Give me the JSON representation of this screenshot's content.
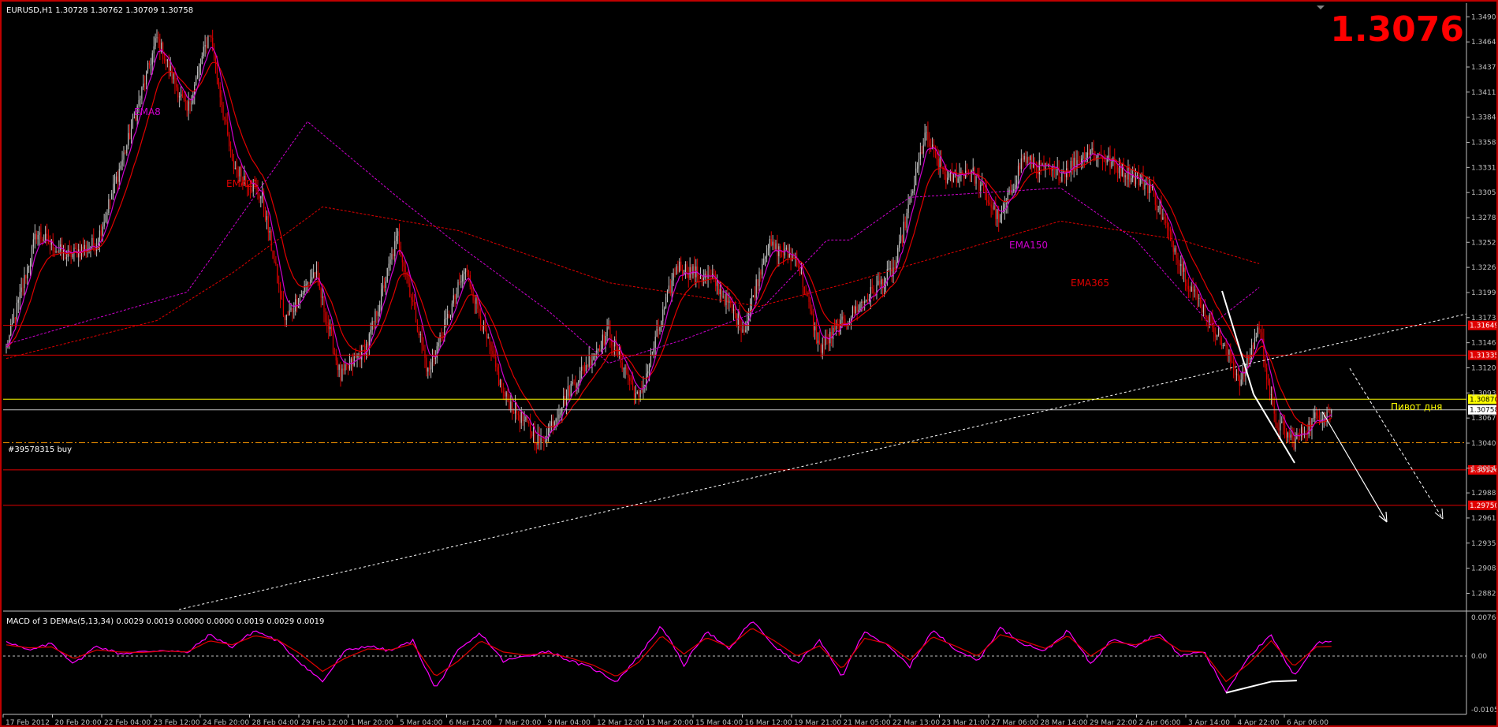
{
  "chart_data": [
    {
      "type": "line",
      "title": "EURUSD,H1  1.30728 1.30762 1.30709 1.30758",
      "big_price": "1.3076",
      "ylim": [
        1.2865,
        1.3505
      ],
      "grid": false,
      "x_tick_labels": [
        "17 Feb 2012",
        "20 Feb 20:00",
        "22 Feb 04:00",
        "23 Feb 12:00",
        "24 Feb 20:00",
        "28 Feb 04:00",
        "29 Feb 12:00",
        "1 Mar 20:00",
        "5 Mar 04:00",
        "6 Mar 12:00",
        "7 Mar 20:00",
        "9 Mar 04:00",
        "12 Mar 12:00",
        "13 Mar 20:00",
        "15 Mar 04:00",
        "16 Mar 12:00",
        "19 Mar 21:00",
        "21 Mar 05:00",
        "22 Mar 13:00",
        "23 Mar 21:00",
        "27 Mar 06:00",
        "28 Mar 14:00",
        "29 Mar 22:00",
        "2 Apr 06:00",
        "3 Apr 14:00",
        "4 Apr 22:00",
        "6 Apr 06:00"
      ],
      "y_tick_labels": [
        "1.34906",
        "1.34641",
        "1.34376",
        "1.34111",
        "1.33846",
        "1.33581",
        "1.33316",
        "1.33051",
        "1.32786",
        "1.32526",
        "1.32261",
        "1.31996",
        "1.31731",
        "1.31466",
        "1.31201",
        "1.30936",
        "1.30671",
        "1.30406",
        "1.30141",
        "1.29881",
        "1.29616",
        "1.29351",
        "1.29086",
        "1.28821"
      ],
      "price_anchors": {
        "x": [
          0,
          20,
          40,
          60,
          80,
          100,
          120,
          135,
          150,
          170,
          185,
          205,
          222,
          240,
          260,
          280,
          305,
          330,
          355,
          375,
          400,
          420,
          445,
          470,
          490,
          505,
          525,
          540,
          560,
          590,
          610,
          625,
          640,
          660,
          675,
          685,
          700,
          720,
          740,
          760,
          785,
          805,
          820,
          832,
          842,
          855,
          870,
          880
        ],
        "y": [
          1.314,
          1.3262,
          1.3238,
          1.3252,
          1.3355,
          1.3468,
          1.339,
          1.3475,
          1.3335,
          1.33,
          1.317,
          1.3222,
          1.311,
          1.3145,
          1.326,
          1.3115,
          1.3225,
          1.3092,
          1.304,
          1.31,
          1.3158,
          1.3085,
          1.3228,
          1.3212,
          1.316,
          1.325,
          1.3235,
          1.314,
          1.3175,
          1.3225,
          1.3365,
          1.3318,
          1.333,
          1.3275,
          1.3342,
          1.3332,
          1.3325,
          1.335,
          1.333,
          1.331,
          1.321,
          1.3155,
          1.3105,
          1.3165,
          1.3065,
          1.3042,
          1.3068,
          1.3076
        ]
      },
      "ema_anchors": {
        "EMA150": {
          "x": [
            0,
            120,
            160,
            200,
            260,
            300,
            360,
            400,
            450,
            500,
            545,
            560,
            600,
            700,
            750,
            800,
            832
          ],
          "y": [
            1.3145,
            1.32,
            1.329,
            1.338,
            1.33,
            1.325,
            1.318,
            1.3125,
            1.315,
            1.318,
            1.3255,
            1.3255,
            1.33,
            1.331,
            1.3255,
            1.3165,
            1.3205
          ]
        },
        "EMA365": {
          "x": [
            0,
            100,
            150,
            210,
            300,
            400,
            500,
            560,
            700,
            780,
            832
          ],
          "y": [
            1.313,
            1.317,
            1.322,
            1.329,
            1.3265,
            1.321,
            1.3185,
            1.321,
            1.3275,
            1.3255,
            1.323
          ]
        }
      },
      "horizontal_levels": [
        {
          "price": 1.31649,
          "label": "1.31649",
          "color": "#e00000"
        },
        {
          "price": 1.31335,
          "label": "1.31335",
          "color": "#e00000"
        },
        {
          "price": 1.3087,
          "label": "1.30870",
          "color": "#ffff00"
        },
        {
          "price": 1.30758,
          "label": "1.30758",
          "color": "#c0c0c0"
        },
        {
          "price": 1.3041,
          "label": "",
          "color": "#ff9900"
        },
        {
          "price": 1.30124,
          "label": "1.30124",
          "color": "#e00000"
        },
        {
          "price": 1.2975,
          "label": "1.29750",
          "color": "#e00000"
        }
      ],
      "ema_labels": [
        "EMA8",
        "EMA21",
        "EMA150",
        "EMA365"
      ],
      "ema_colors": {
        "EMA8": "#d000d0",
        "EMA21": "#e00000",
        "EMA150": "#d000d0",
        "EMA365": "#e00000"
      },
      "order_label": "#39578315 buy",
      "pivot_label": "Пивот дня",
      "colors": {
        "frame": "#c00000",
        "bull": "#c0c0c0",
        "bear": "#e00000",
        "big_price": "#ff0000",
        "axis": "#c0c0c0"
      }
    },
    {
      "type": "line",
      "title": "MACD of 3 DEMAs(5,13,34) 0.0029 0.0019 0.0000 0.0000 0.0019 0.0029 0.0019",
      "ylim": [
        -0.0105,
        0.0082
      ],
      "y_tick_labels": [
        "0.0076",
        "0.00",
        "-0.0105"
      ],
      "series": [
        {
          "color": "#ff00ff",
          "x": [
            0,
            15,
            30,
            45,
            60,
            75,
            90,
            105,
            120,
            135,
            150,
            165,
            180,
            195,
            210,
            225,
            240,
            255,
            270,
            285,
            300,
            315,
            330,
            345,
            360,
            375,
            390,
            405,
            420,
            435,
            450,
            465,
            480,
            495,
            510,
            525,
            540,
            555,
            570,
            585,
            600,
            615,
            630,
            645,
            660,
            675,
            690,
            705,
            720,
            735,
            750,
            765,
            780,
            795,
            810,
            825,
            840,
            855,
            870,
            880
          ],
          "y": [
            0.003,
            0.001,
            0.0025,
            -0.0015,
            0.002,
            0.0005,
            0.0008,
            0.0012,
            0.0006,
            0.0042,
            0.0018,
            0.005,
            0.003,
            -0.0012,
            -0.005,
            0.001,
            0.002,
            0.001,
            0.003,
            -0.0065,
            0.001,
            0.0045,
            -0.001,
            0.0,
            0.001,
            -0.001,
            -0.0025,
            -0.005,
            0.0,
            0.006,
            -0.0018,
            0.005,
            0.0012,
            0.007,
            0.002,
            -0.0015,
            0.003,
            -0.004,
            0.005,
            0.002,
            -0.002,
            0.005,
            0.0015,
            -0.001,
            0.0055,
            0.0025,
            0.001,
            0.005,
            -0.0015,
            0.0035,
            0.002,
            0.0045,
            0.0,
            0.001,
            -0.007,
            0.0,
            0.004,
            -0.004,
            0.0025,
            0.0029
          ]
        },
        {
          "color": "#e00000",
          "x": [
            0,
            15,
            30,
            45,
            60,
            75,
            90,
            105,
            120,
            135,
            150,
            165,
            180,
            195,
            210,
            225,
            240,
            255,
            270,
            285,
            300,
            315,
            330,
            345,
            360,
            375,
            390,
            405,
            420,
            435,
            450,
            465,
            480,
            495,
            510,
            525,
            540,
            555,
            570,
            585,
            600,
            615,
            630,
            645,
            660,
            675,
            690,
            705,
            720,
            735,
            750,
            765,
            780,
            795,
            810,
            825,
            840,
            855,
            870,
            880
          ],
          "y": [
            0.0022,
            0.0016,
            0.0018,
            -0.0005,
            0.0012,
            0.0008,
            0.0007,
            0.001,
            0.0008,
            0.003,
            0.0022,
            0.004,
            0.0032,
            0.0005,
            -0.003,
            -0.0004,
            0.0014,
            0.0012,
            0.0024,
            -0.004,
            -0.001,
            0.003,
            0.0008,
            0.0002,
            0.0006,
            -0.0004,
            -0.0018,
            -0.004,
            -0.0012,
            0.004,
            0.0004,
            0.0036,
            0.0018,
            0.0055,
            0.003,
            0.0,
            0.002,
            -0.0025,
            0.0035,
            0.0024,
            -0.0008,
            0.0038,
            0.002,
            0.0,
            0.0042,
            0.003,
            0.0015,
            0.004,
            0.0,
            0.0028,
            0.0022,
            0.0038,
            0.001,
            0.0008,
            -0.005,
            -0.0015,
            0.003,
            -0.002,
            0.0018,
            0.0019
          ]
        }
      ]
    }
  ]
}
